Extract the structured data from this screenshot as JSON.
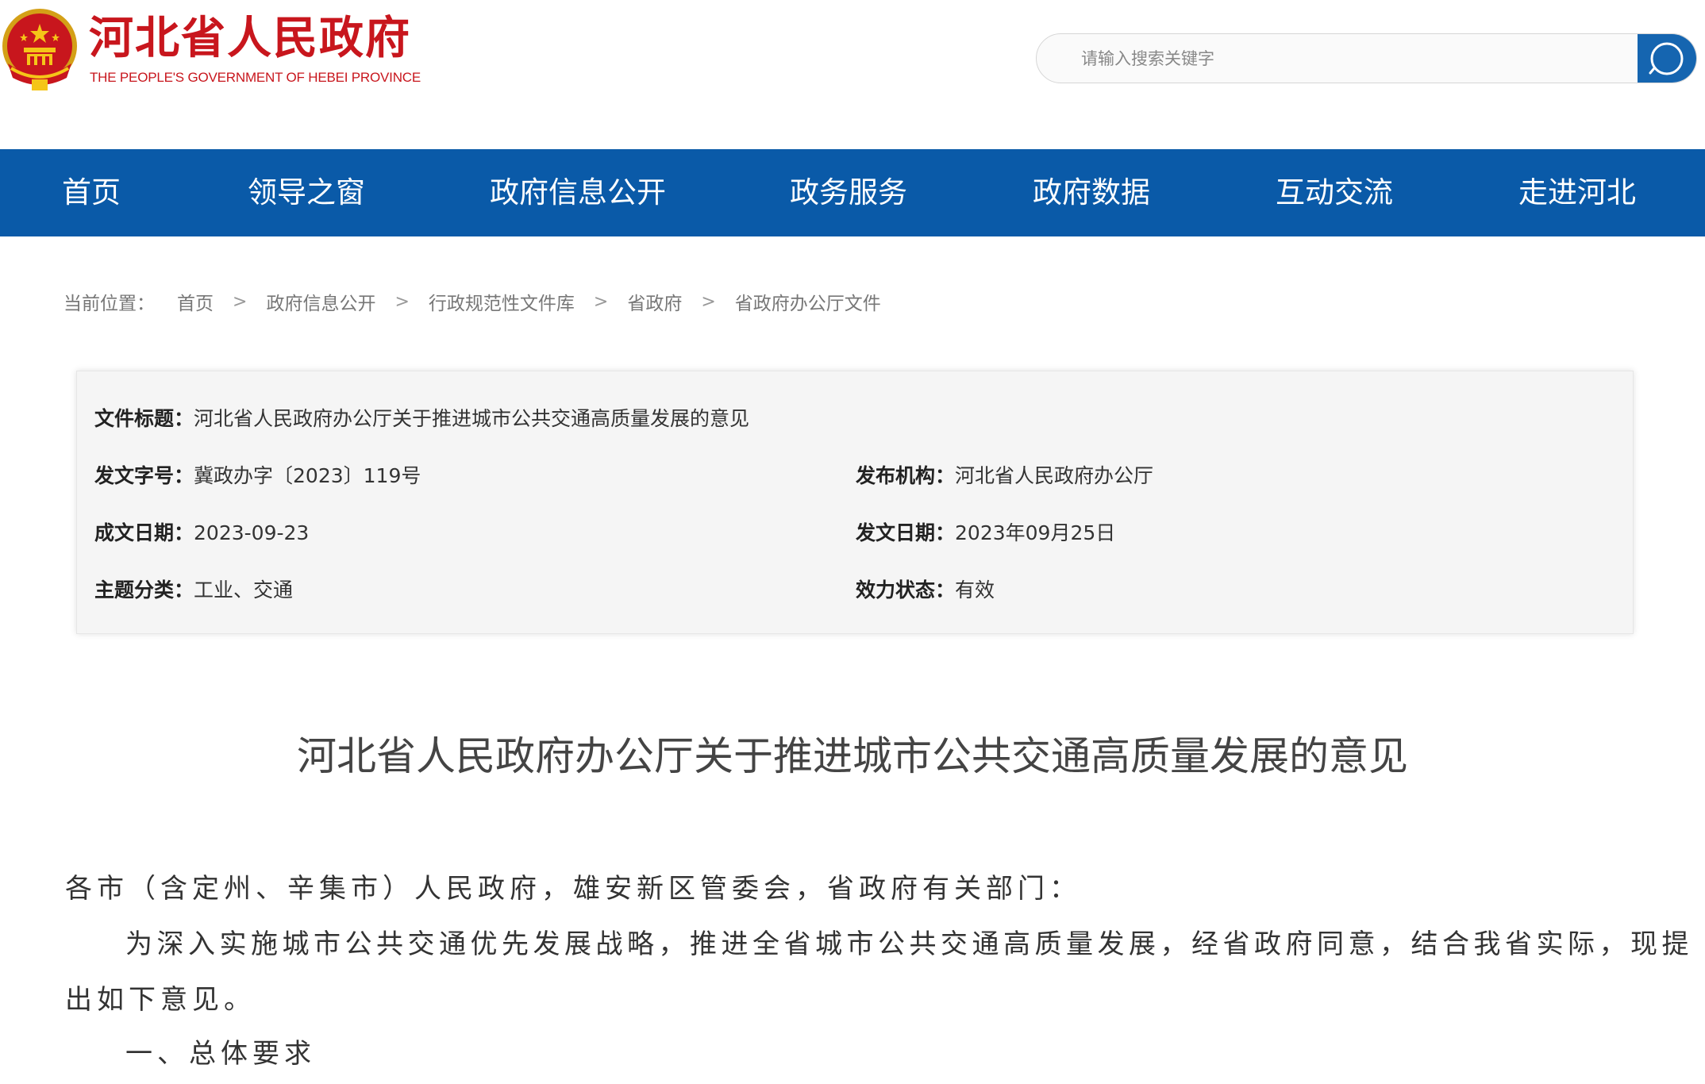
{
  "header": {
    "site_title": "河北省人民政府",
    "site_subtitle": "THE PEOPLE'S GOVERNMENT OF HEBEI PROVINCE",
    "search": {
      "placeholder": "请输入搜索关键字",
      "value": ""
    },
    "icons": {
      "emblem": "national-emblem-icon",
      "search": "search-icon"
    },
    "colors": {
      "brand_red": "#c8161d",
      "nav_blue": "#0a5aa8",
      "search_button": "#1565b0"
    }
  },
  "nav": {
    "items": [
      {
        "label": "首页"
      },
      {
        "label": "领导之窗"
      },
      {
        "label": "政府信息公开"
      },
      {
        "label": "政务服务"
      },
      {
        "label": "政府数据"
      },
      {
        "label": "互动交流"
      },
      {
        "label": "走进河北"
      }
    ]
  },
  "breadcrumb": {
    "label": "当前位置：",
    "items": [
      "首页",
      "政府信息公开",
      "行政规范性文件库",
      "省政府",
      "省政府办公厅文件"
    ],
    "separator": ">"
  },
  "meta": {
    "title_key": "文件标题：",
    "title_val": "河北省人民政府办公厅关于推进城市公共交通高质量发展的意见",
    "doc_no_key": "发文字号：",
    "doc_no_val": "冀政办字〔2023〕119号",
    "issuer_key": "发布机构：",
    "issuer_val": "河北省人民政府办公厅",
    "written_key": "成文日期：",
    "written_val": "2023-09-23",
    "published_key": "发文日期：",
    "published_val": "2023年09月25日",
    "topic_key": "主题分类：",
    "topic_val": "工业、交通",
    "status_key": "效力状态：",
    "status_val": "有效"
  },
  "article": {
    "title": "河北省人民政府办公厅关于推进城市公共交通高质量发展的意见",
    "paragraphs": [
      "各市（含定州、辛集市）人民政府，雄安新区管委会，省政府有关部门：",
      "为深入实施城市公共交通优先发展战略，推进全省城市公共交通高质量发展，经省政府同意，结合我省实际，现提",
      "出如下意见。",
      "一、总体要求"
    ]
  }
}
